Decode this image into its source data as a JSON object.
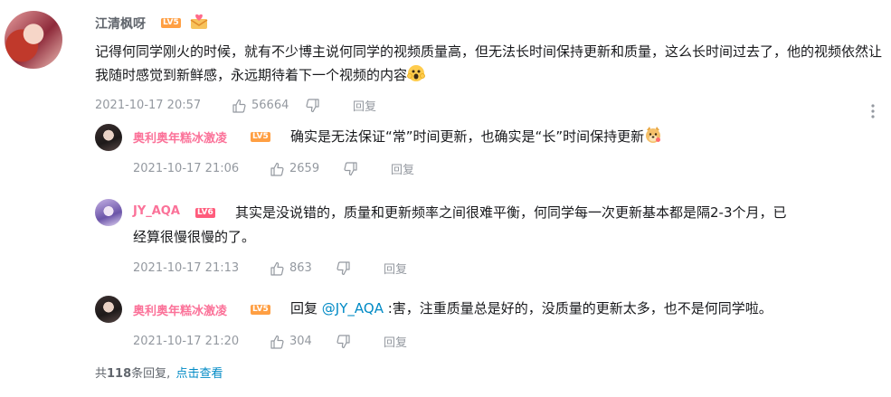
{
  "comment": {
    "username": "江清枫呀",
    "level": "LV5",
    "text": "记得何同学刚火的时候，就有不少博主说何同学的视频质量高，但无法长时间保持更新和质量，这么长时间过去了，他的视频依然让我随时感觉到新鲜感，永远期待着下一个视频的内容",
    "time": "2021-10-17 20:57",
    "likes": "56664",
    "reply_label": "回复"
  },
  "replies": [
    {
      "username": "奥利奥年糕冰激凌",
      "level": "LV5",
      "text": "确实是无法保证“常”时间更新，也确实是“长”时间保持更新",
      "time": "2021-10-17 21:06",
      "likes": "2659",
      "reply_label": "回复"
    },
    {
      "username": "JY_AQA",
      "level": "LV6",
      "text_line1": "其实是没说错的，质量和更新频率之间很难平衡，何同学每一次更新基本都是隔2-3个月，已",
      "text_line2": "经算很慢很慢的了。",
      "time": "2021-10-17 21:13",
      "likes": "863",
      "reply_label": "回复"
    },
    {
      "username": "奥利奥年糕冰激凌",
      "level": "LV5",
      "prefix": "回复",
      "mention": "@JY_AQA",
      "text": ":害，注重质量总是好的，没质量的更新太多，也不是何同学啦。",
      "time": "2021-10-17 21:20",
      "likes": "304",
      "reply_label": "回复"
    }
  ],
  "footer": {
    "pre": "共",
    "count": "118",
    "post": "条回复,",
    "view_label": "点击查看"
  },
  "icons": {
    "like": "thumbs-up-icon",
    "dislike": "thumbs-down-icon",
    "more": "more-vertical-icon"
  }
}
